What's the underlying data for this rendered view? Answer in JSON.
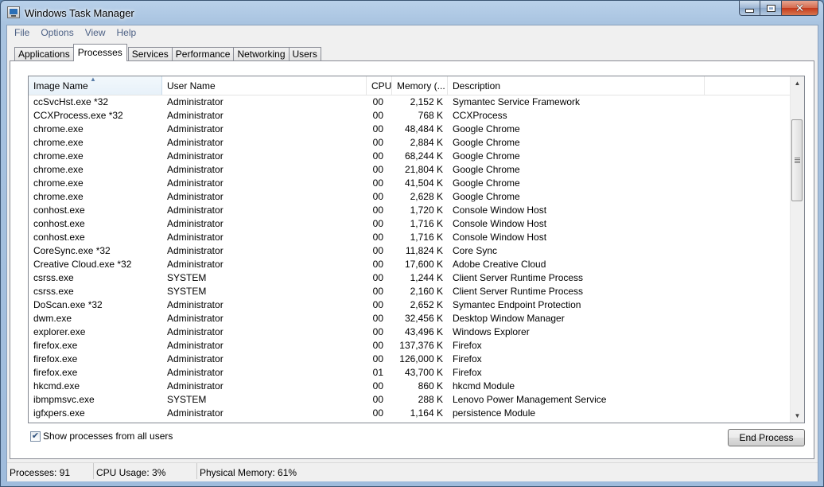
{
  "window": {
    "title": "Windows Task Manager"
  },
  "menu": [
    "File",
    "Options",
    "View",
    "Help"
  ],
  "tabs": [
    {
      "label": "Applications",
      "active": false
    },
    {
      "label": "Processes",
      "active": true
    },
    {
      "label": "Services",
      "active": false
    },
    {
      "label": "Performance",
      "active": false
    },
    {
      "label": "Networking",
      "active": false
    },
    {
      "label": "Users",
      "active": false
    }
  ],
  "columns": {
    "image_name": "Image Name",
    "user_name": "User Name",
    "cpu": "CPU",
    "memory": "Memory (...",
    "description": "Description"
  },
  "processes": [
    {
      "image": "ccSvcHst.exe *32",
      "user": "Administrator",
      "cpu": "00",
      "memory": "2,152 K",
      "description": "Symantec Service Framework"
    },
    {
      "image": "CCXProcess.exe *32",
      "user": "Administrator",
      "cpu": "00",
      "memory": "768 K",
      "description": "CCXProcess"
    },
    {
      "image": "chrome.exe",
      "user": "Administrator",
      "cpu": "00",
      "memory": "48,484 K",
      "description": "Google Chrome"
    },
    {
      "image": "chrome.exe",
      "user": "Administrator",
      "cpu": "00",
      "memory": "2,884 K",
      "description": "Google Chrome"
    },
    {
      "image": "chrome.exe",
      "user": "Administrator",
      "cpu": "00",
      "memory": "68,244 K",
      "description": "Google Chrome"
    },
    {
      "image": "chrome.exe",
      "user": "Administrator",
      "cpu": "00",
      "memory": "21,804 K",
      "description": "Google Chrome"
    },
    {
      "image": "chrome.exe",
      "user": "Administrator",
      "cpu": "00",
      "memory": "41,504 K",
      "description": "Google Chrome"
    },
    {
      "image": "chrome.exe",
      "user": "Administrator",
      "cpu": "00",
      "memory": "2,628 K",
      "description": "Google Chrome"
    },
    {
      "image": "conhost.exe",
      "user": "Administrator",
      "cpu": "00",
      "memory": "1,720 K",
      "description": "Console Window Host"
    },
    {
      "image": "conhost.exe",
      "user": "Administrator",
      "cpu": "00",
      "memory": "1,716 K",
      "description": "Console Window Host"
    },
    {
      "image": "conhost.exe",
      "user": "Administrator",
      "cpu": "00",
      "memory": "1,716 K",
      "description": "Console Window Host"
    },
    {
      "image": "CoreSync.exe *32",
      "user": "Administrator",
      "cpu": "00",
      "memory": "11,824 K",
      "description": "Core Sync"
    },
    {
      "image": "Creative Cloud.exe *32",
      "user": "Administrator",
      "cpu": "00",
      "memory": "17,600 K",
      "description": "Adobe Creative Cloud"
    },
    {
      "image": "csrss.exe",
      "user": "SYSTEM",
      "cpu": "00",
      "memory": "1,244 K",
      "description": "Client Server Runtime Process"
    },
    {
      "image": "csrss.exe",
      "user": "SYSTEM",
      "cpu": "00",
      "memory": "2,160 K",
      "description": "Client Server Runtime Process"
    },
    {
      "image": "DoScan.exe *32",
      "user": "Administrator",
      "cpu": "00",
      "memory": "2,652 K",
      "description": "Symantec Endpoint Protection"
    },
    {
      "image": "dwm.exe",
      "user": "Administrator",
      "cpu": "00",
      "memory": "32,456 K",
      "description": "Desktop Window Manager"
    },
    {
      "image": "explorer.exe",
      "user": "Administrator",
      "cpu": "00",
      "memory": "43,496 K",
      "description": "Windows Explorer"
    },
    {
      "image": "firefox.exe",
      "user": "Administrator",
      "cpu": "00",
      "memory": "137,376 K",
      "description": "Firefox"
    },
    {
      "image": "firefox.exe",
      "user": "Administrator",
      "cpu": "00",
      "memory": "126,000 K",
      "description": "Firefox"
    },
    {
      "image": "firefox.exe",
      "user": "Administrator",
      "cpu": "01",
      "memory": "43,700 K",
      "description": "Firefox"
    },
    {
      "image": "hkcmd.exe",
      "user": "Administrator",
      "cpu": "00",
      "memory": "860 K",
      "description": "hkcmd Module"
    },
    {
      "image": "ibmpmsvc.exe",
      "user": "SYSTEM",
      "cpu": "00",
      "memory": "288 K",
      "description": "Lenovo Power Management Service"
    },
    {
      "image": "igfxpers.exe",
      "user": "Administrator",
      "cpu": "00",
      "memory": "1,164 K",
      "description": "persistence Module"
    }
  ],
  "show_all": {
    "label": "Show processes from all users",
    "checked": true
  },
  "end_process_label": "End Process",
  "status": {
    "processes": "Processes: 91",
    "cpu": "CPU Usage: 3%",
    "memory": "Physical Memory: 61%"
  }
}
